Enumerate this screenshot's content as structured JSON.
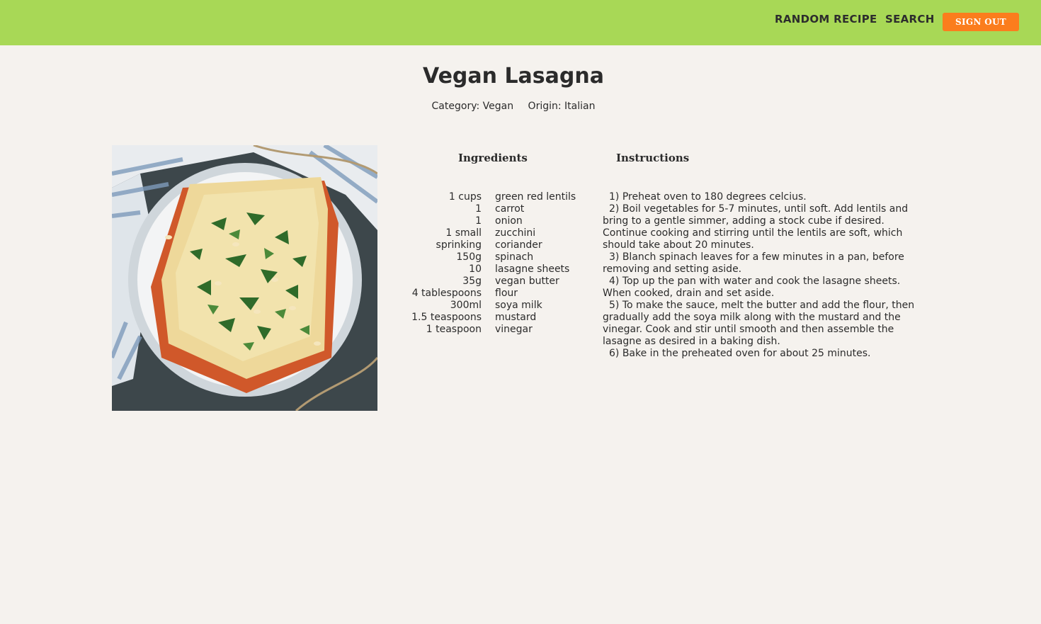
{
  "nav": {
    "random_recipe": "RANDOM RECIPE",
    "search": "SEARCH",
    "sign_out": "SIGN OUT"
  },
  "recipe": {
    "title": "Vegan Lasagna",
    "category_label": "Category:",
    "category": "Vegan",
    "origin_label": "Origin:",
    "origin": "Italian",
    "ingredients_heading": "Ingredients",
    "instructions_heading": "Instructions",
    "ingredients": [
      {
        "qty": "1 cups",
        "name": "green red lentils"
      },
      {
        "qty": "1",
        "name": "carrot"
      },
      {
        "qty": "1",
        "name": "onion"
      },
      {
        "qty": "1 small",
        "name": "zucchini"
      },
      {
        "qty": "sprinking",
        "name": "coriander"
      },
      {
        "qty": "150g",
        "name": "spinach"
      },
      {
        "qty": "10",
        "name": "lasagne sheets"
      },
      {
        "qty": "35g",
        "name": "vegan butter"
      },
      {
        "qty": "4 tablespoons",
        "name": "flour"
      },
      {
        "qty": "300ml",
        "name": "soya milk"
      },
      {
        "qty": "1.5 teaspoons",
        "name": "mustard"
      },
      {
        "qty": "1 teaspoon",
        "name": "vinegar"
      }
    ],
    "instructions": [
      "1) Preheat oven to 180 degrees celcius.",
      "2) Boil vegetables for 5-7 minutes, until soft. Add lentils and bring to a gentle simmer, adding a stock cube if desired. Continue cooking and stirring until the lentils are soft, which should take about 20 minutes.",
      "3) Blanch spinach leaves for a few minutes in a pan, before removing and setting aside.",
      "4) Top up the pan with water and cook the lasagne sheets. When cooked, drain and set aside.",
      "5) To make the sauce, melt the butter and add the flour, then gradually add the soya milk along with the mustard and the vinegar. Cook and stir until smooth and then assemble the lasagne as desired in a baking dish.",
      "6) Bake in the preheated oven for about 25 minutes."
    ]
  },
  "colors": {
    "header_bg": "#a8d856",
    "signout_bg": "#fb7d1d",
    "page_bg": "#f5f2ee"
  }
}
